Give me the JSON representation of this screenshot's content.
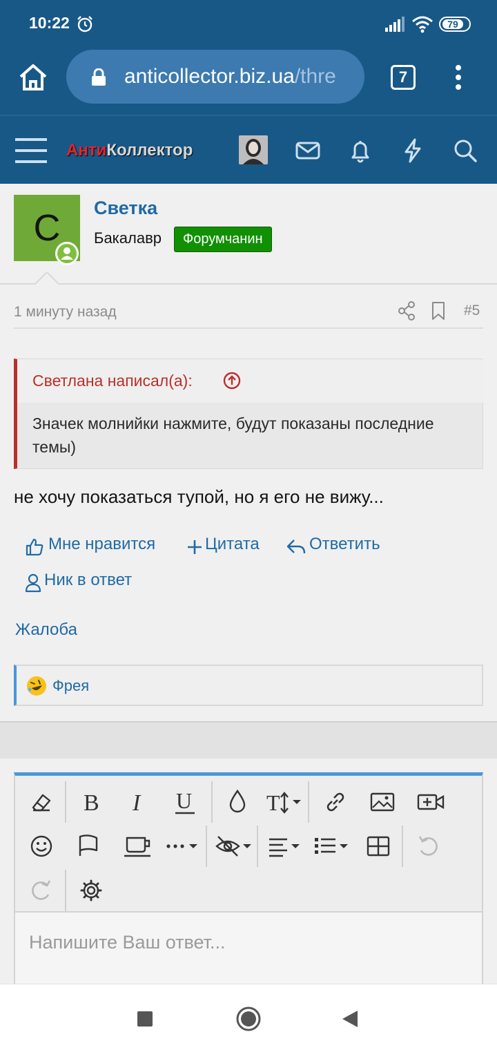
{
  "status_bar": {
    "time": "10:22",
    "battery": "79",
    "icons": [
      "alarm-icon",
      "signal-icon",
      "wifi-icon",
      "battery-icon"
    ]
  },
  "browser": {
    "url_main": "anticollector.biz.ua",
    "url_rest": "/thre",
    "tab_count": "7",
    "icons": [
      "home-icon",
      "lock-icon",
      "more-vert-icon"
    ]
  },
  "site_nav": {
    "logo_red": "Анти",
    "logo_grey": "Коллектор",
    "icons": [
      "menu-icon",
      "avatar",
      "mail-icon",
      "bell-icon",
      "lightning-icon",
      "search-icon"
    ]
  },
  "post": {
    "avatar_letter": "С",
    "username": "Светка",
    "rank": "Бакалавр",
    "badge": "Форумчанин",
    "date": "1 минуту назад",
    "number": "#5",
    "quote_author": "Светлана написал(а):",
    "quote_text": "Значек молнийки нажмите, будут показаны последние темы)",
    "message": "не хочу показаться тупой, но я его не вижу..."
  },
  "actions": {
    "like": "Мне нравится",
    "quote": "Цитата",
    "reply": "Ответить",
    "mention": "Ник в ответ",
    "report": "Жалоба"
  },
  "reactions": {
    "user": "Фрея",
    "emoji": "rofl-emoji"
  },
  "editor": {
    "placeholder": "Напишите Ваш ответ...",
    "tools": [
      "eraser-icon",
      "bold-icon",
      "italic-icon",
      "underline-icon",
      "color-icon",
      "text-size-icon",
      "link-icon",
      "image-icon",
      "video-icon",
      "smile-icon",
      "flag-icon",
      "mug-icon",
      "more-options-icon",
      "hide-icon",
      "align-icon",
      "list-icon",
      "table-icon",
      "undo-icon",
      "redo-icon",
      "settings-icon"
    ]
  },
  "colors": {
    "brand_blue": "#185886",
    "link_blue": "#1f6aa6",
    "badge_green": "#119004",
    "quote_red": "#b9302a",
    "avatar_green": "#6faa38"
  }
}
